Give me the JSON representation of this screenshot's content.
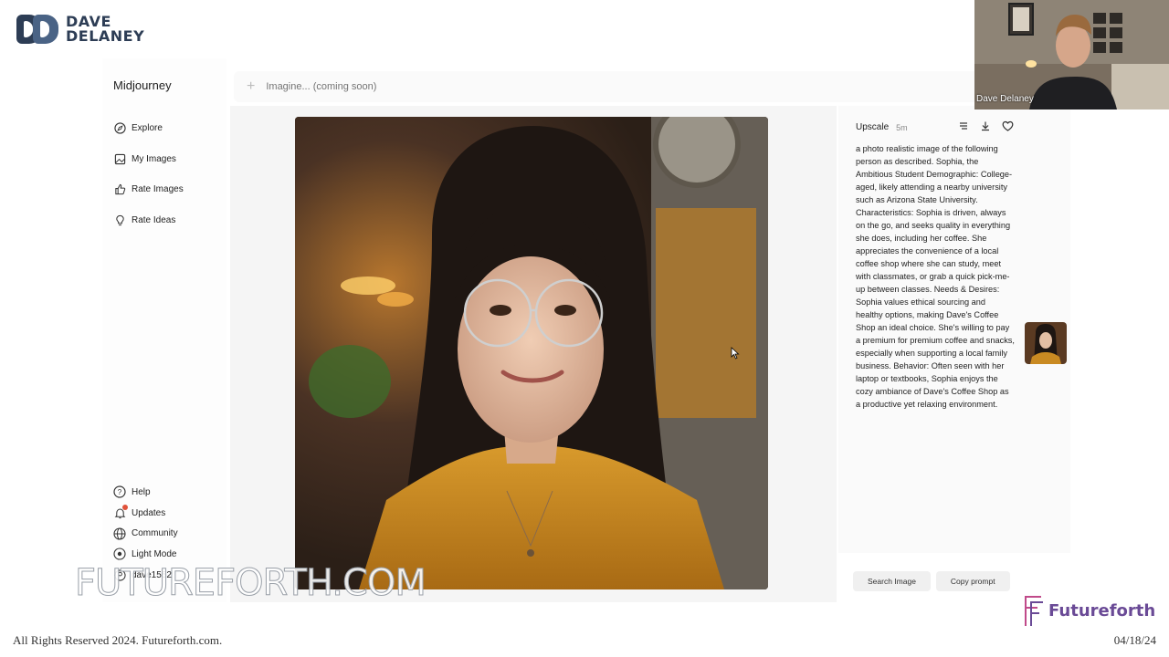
{
  "brand": {
    "line1": "DAVE",
    "line2": "DELANEY"
  },
  "app": {
    "title": "Midjourney",
    "nav": [
      {
        "label": "Explore",
        "icon": "compass-icon"
      },
      {
        "label": "My Images",
        "icon": "image-icon"
      },
      {
        "label": "Rate Images",
        "icon": "thumbs-up-icon"
      },
      {
        "label": "Rate Ideas",
        "icon": "lightbulb-icon"
      }
    ],
    "bottom_nav": [
      {
        "label": "Help",
        "icon": "help-icon"
      },
      {
        "label": "Updates",
        "icon": "bell-icon"
      },
      {
        "label": "Community",
        "icon": "globe-icon"
      },
      {
        "label": "Light Mode",
        "icon": "sun-icon"
      },
      {
        "label": "dave1552",
        "icon": "user-icon"
      }
    ],
    "prompt_placeholder": "Imagine... (coming soon)"
  },
  "info": {
    "type": "Upscale",
    "time": "5m",
    "prompt": "a photo realistic image of the following person as described. Sophia, the Ambitious Student Demographic: College-aged, likely attending a nearby university such as Arizona State University. Characteristics: Sophia is driven, always on the go, and seeks quality in everything she does, including her coffee. She appreciates the convenience of a local coffee shop where she can study, meet with classmates, or grab a quick pick-me-up between classes. Needs & Desires: Sophia values ethical sourcing and healthy options, making Dave's Coffee Shop an ideal choice. She's willing to pay a premium for premium coffee and snacks, especially when supporting a local family business. Behavior: Often seen with her laptop or textbooks, Sophia enjoys the cozy ambiance of Dave's Coffee Shop as a productive yet relaxing environment.",
    "search_label": "Search Image",
    "copy_label": "Copy prompt"
  },
  "webcam": {
    "name": "Dave Delaney"
  },
  "watermark": "FUTUREFORTH.COM",
  "footer": {
    "left": "All Rights Reserved 2024. Futureforth.com.",
    "right": "04/18/24",
    "logo_text": "Futureforth"
  },
  "colors": {
    "brand": "#2d3d55",
    "futureforth": "#6a4a96",
    "shirt": "#c98a22"
  }
}
